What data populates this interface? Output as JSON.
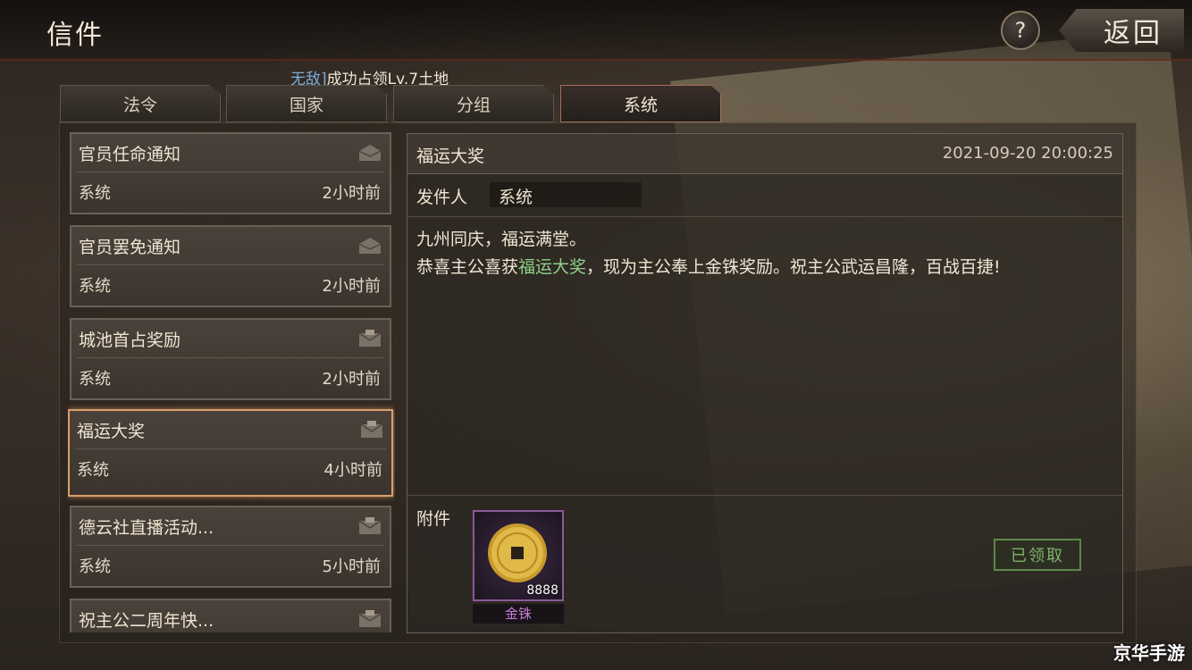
{
  "header": {
    "title": "信件",
    "help_label": "?",
    "back_label": "返回"
  },
  "ticker": {
    "highlight": "无敌]",
    "text": "成功占领Lv.7土地"
  },
  "tabs": [
    {
      "label": "法令",
      "active": false
    },
    {
      "label": "国家",
      "active": false
    },
    {
      "label": "分组",
      "active": false
    },
    {
      "label": "系统",
      "active": true
    }
  ],
  "mails": [
    {
      "title": "官员任命通知",
      "sender": "系统",
      "time": "2小时前",
      "icon": "envelope-open-icon"
    },
    {
      "title": "官员罢免通知",
      "sender": "系统",
      "time": "2小时前",
      "icon": "envelope-open-icon"
    },
    {
      "title": "城池首占奖励",
      "sender": "系统",
      "time": "2小时前",
      "icon": "envelope-attachment-icon"
    },
    {
      "title": "福运大奖",
      "sender": "系统",
      "time": "4小时前",
      "icon": "envelope-attachment-icon",
      "selected": true
    },
    {
      "title": "德云社直播活动...",
      "sender": "系统",
      "time": "5小时前",
      "icon": "envelope-attachment-icon"
    },
    {
      "title": "祝主公二周年快...",
      "sender": "系统",
      "time": "",
      "icon": "envelope-attachment-icon"
    }
  ],
  "detail": {
    "title": "福运大奖",
    "datetime": "2021-09-20 20:00:25",
    "sender_label": "发件人",
    "sender": "系统",
    "body_line1": "九州同庆，福运满堂。",
    "body_pre": "恭喜主公喜获",
    "body_highlight": "福运大奖",
    "body_post": "，现为主公奉上金铢奖励。祝主公武运昌隆，百战百捷!",
    "attachment_label": "附件",
    "attachment": {
      "name": "金铢",
      "quantity": "8888",
      "icon": "gold-coin-icon"
    },
    "claimed_label": "已领取"
  },
  "watermark": "京华手游"
}
